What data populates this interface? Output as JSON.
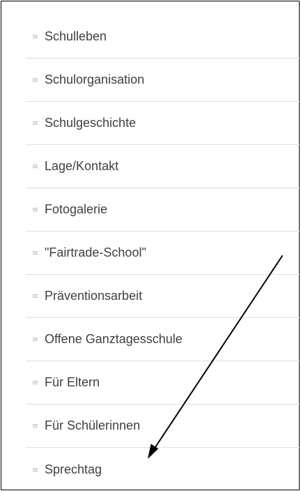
{
  "menu": {
    "items": [
      {
        "label": "Schulleben"
      },
      {
        "label": "Schulorganisation"
      },
      {
        "label": "Schulgeschichte"
      },
      {
        "label": "Lage/Kontakt"
      },
      {
        "label": "Fotogalerie"
      },
      {
        "label": "\"Fairtrade-School\""
      },
      {
        "label": "Präventionsarbeit"
      },
      {
        "label": "Offene Ganztagesschule"
      },
      {
        "label": "Für Eltern"
      },
      {
        "label": "Für Schülerinnen"
      },
      {
        "label": "Sprechtag"
      }
    ]
  },
  "colors": {
    "text": "#3f3f3f",
    "bullet": "#bdbdbd",
    "divider": "#dedede",
    "border": "#000000",
    "arrow": "#000000"
  },
  "icons": {
    "bullet": "striped-square-bullet-icon",
    "annotation": "arrow-icon"
  }
}
